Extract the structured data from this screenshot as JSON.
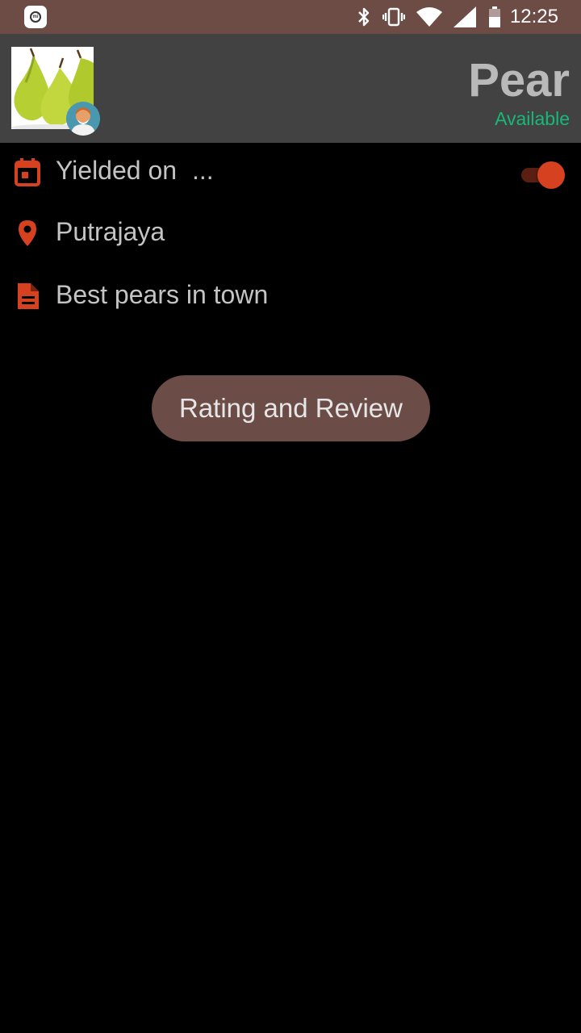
{
  "status_bar": {
    "time": "12:25",
    "icons": [
      "app-notification-icon",
      "bluetooth-icon",
      "vibrate-icon",
      "wifi-icon",
      "signal-icon",
      "battery-icon"
    ]
  },
  "header": {
    "title": "Pear",
    "status": "Available",
    "status_color": "#17b978",
    "background": "#424242"
  },
  "details": {
    "yield_label": "Yielded on",
    "yield_value": "...",
    "location": "Putrajaya",
    "description": "Best pears in town",
    "toggle_on": true
  },
  "actions": {
    "review_label": "Rating and Review"
  },
  "colors": {
    "status_bar": "#6d4c45",
    "accent": "#d6421f",
    "button": "#6b4c46"
  }
}
